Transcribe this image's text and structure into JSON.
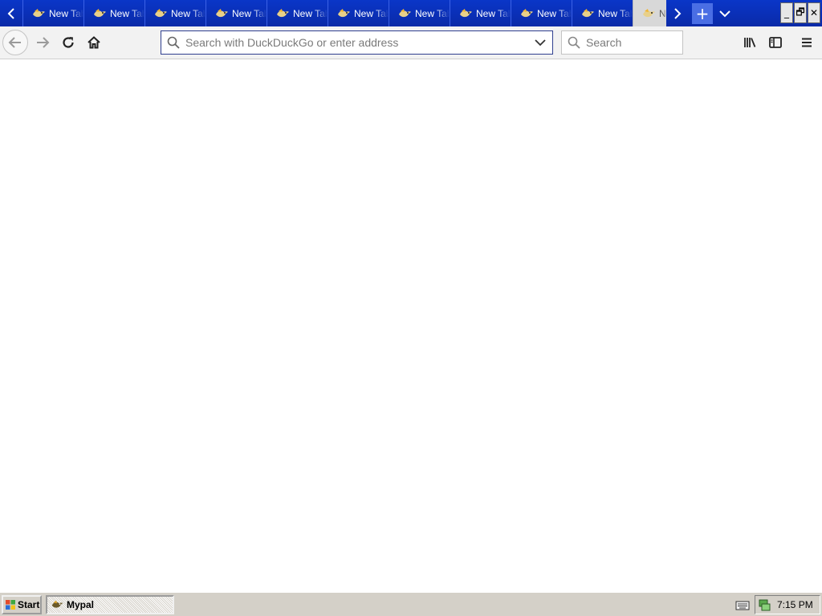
{
  "tabstrip": {
    "tabs": [
      {
        "label": "New Tab",
        "active": false
      },
      {
        "label": "New Tab",
        "active": false
      },
      {
        "label": "New Tab",
        "active": false
      },
      {
        "label": "New Tab",
        "active": false
      },
      {
        "label": "New Tab",
        "active": false
      },
      {
        "label": "New Tab",
        "active": false
      },
      {
        "label": "New Tab",
        "active": false
      },
      {
        "label": "New Tab",
        "active": false
      },
      {
        "label": "New Tab",
        "active": false
      },
      {
        "label": "New Tab",
        "active": false
      },
      {
        "label": "New Tab",
        "active": true
      }
    ],
    "new_tab_label": "+",
    "scroll_left_icon": "chevron-left-icon",
    "scroll_right_icon": "chevron-right-icon",
    "list_all_tabs_icon": "chevron-down-icon"
  },
  "window_controls": {
    "minimize": "_",
    "restore": "🗗",
    "close": "✕"
  },
  "navbar": {
    "back_icon": "arrow-left-icon",
    "forward_icon": "arrow-right-icon",
    "reload_icon": "reload-icon",
    "home_icon": "home-icon",
    "urlbar": {
      "placeholder": "Search with DuckDuckGo or enter address",
      "value": ""
    },
    "searchbar": {
      "placeholder": "Search",
      "value": ""
    },
    "library_icon": "library-icon",
    "sidebar_icon": "sidebar-icon",
    "menu_icon": "hamburger-menu-icon"
  },
  "taskbar": {
    "start_label": "Start",
    "task_label": "Mypal",
    "clock": "7:15 PM"
  },
  "colors": {
    "tabstrip_bg": "#0a36c8",
    "toolbar_bg": "#f2f2f2",
    "taskbar_bg": "#d4d0c8",
    "urlbar_border": "#2f3f8f"
  }
}
